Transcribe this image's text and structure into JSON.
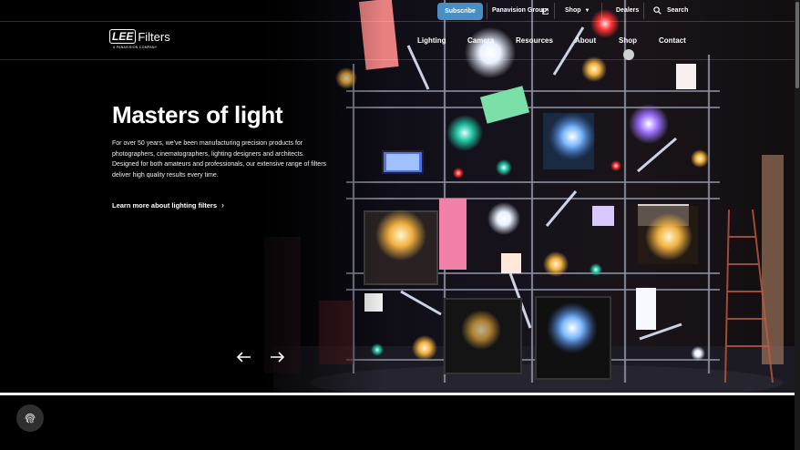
{
  "utility_bar": {
    "subscribe_label": "Subscribe",
    "panavision_label": "Panavision Group",
    "shop_label": "Shop",
    "dealers_label": "Dealers",
    "search_label": "Search"
  },
  "logo": {
    "lee": "LEE",
    "word": "Filters",
    "tagline": "A PANAVISION COMPANY"
  },
  "nav": {
    "items": [
      "Lighting",
      "Camera",
      "Resources",
      "About",
      "Shop",
      "Contact"
    ]
  },
  "hero": {
    "title": "Masters of light",
    "body": "For over 50 years, we've been manufacturing precision products for photographers, cinematographers, lighting designers and architects. Designed for both amateurs and professionals, our extensive range of filters deliver high quality results every time.",
    "link_label": "Learn more about lighting filters"
  },
  "colors": {
    "subscribe_bg": "#4a8fc4",
    "background": "#000000"
  },
  "icons": {
    "search": "search-icon",
    "prev": "arrow-left-icon",
    "next": "arrow-right-icon",
    "fingerprint": "fingerprint-icon"
  }
}
